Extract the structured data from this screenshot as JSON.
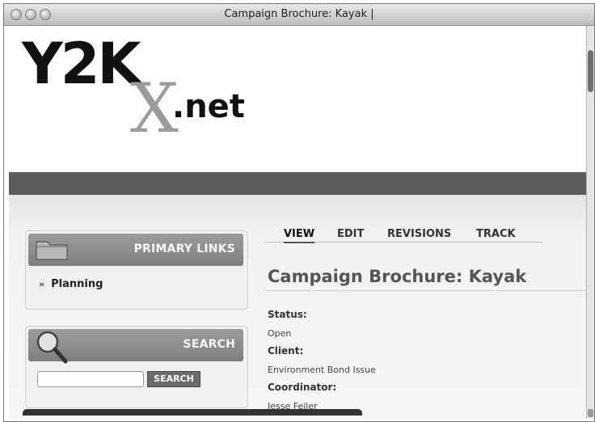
{
  "window": {
    "title": "Campaign Brochure: Kayak |"
  },
  "site": {
    "logo_main": "Y2K",
    "logo_x": "X",
    "logo_net": ".net"
  },
  "sidebar": {
    "primary_links": {
      "title": "PRIMARY LINKS",
      "items": [
        {
          "label": "Planning"
        }
      ]
    },
    "search": {
      "title": "SEARCH",
      "input_value": "",
      "button_label": "SEARCH"
    }
  },
  "tabs": [
    {
      "label": "VIEW",
      "active": true
    },
    {
      "label": "EDIT",
      "active": false
    },
    {
      "label": "REVISIONS",
      "active": false
    },
    {
      "label": "TRACK",
      "active": false
    }
  ],
  "node": {
    "title": "Campaign Brochure: Kayak",
    "fields": [
      {
        "label": "Status:",
        "value": "Open"
      },
      {
        "label": "Client:",
        "value": "Environment Bond Issue"
      },
      {
        "label": "Coordinator:",
        "value": "Jesse Feiler"
      }
    ]
  },
  "icons": {
    "window_controls": [
      "close-icon",
      "minimize-icon",
      "zoom-icon"
    ],
    "primary_links": "folder-icon",
    "search": "magnifying-glass-icon"
  }
}
